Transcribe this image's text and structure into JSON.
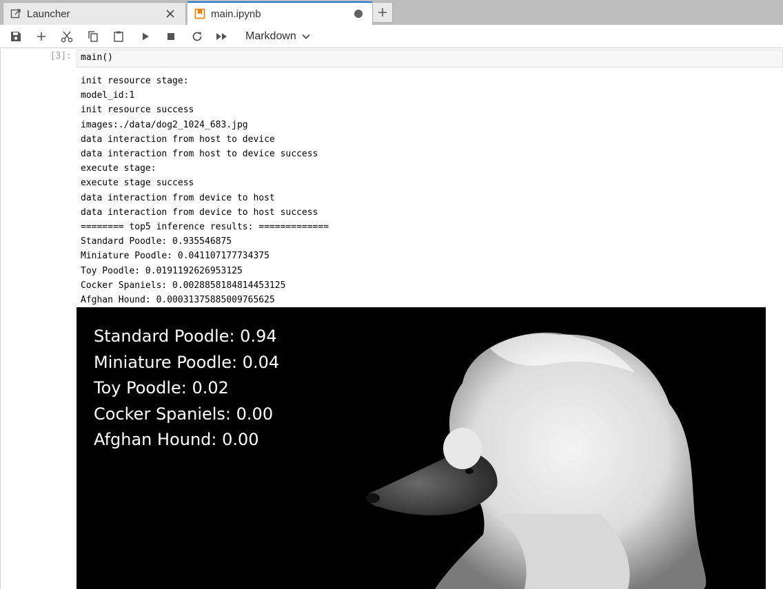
{
  "tabs": [
    {
      "label": "Launcher",
      "icon": "launcher-icon",
      "state": "inactive"
    },
    {
      "label": "main.ipynb",
      "icon": "notebook-icon",
      "state": "active-unsaved"
    }
  ],
  "toolbar": {
    "buttons": [
      "save-icon",
      "add-cell-icon",
      "cut-icon",
      "copy-icon",
      "paste-icon",
      "run-icon",
      "stop-icon",
      "restart-icon",
      "run-all-icon"
    ],
    "cell_type": "Markdown"
  },
  "cell": {
    "prompt": "[3]:",
    "input": "main()",
    "output_lines": [
      "init resource stage:",
      "model_id:1",
      "init resource success",
      "images:./data/dog2_1024_683.jpg",
      "data interaction from host to device",
      "data interaction from host to device success",
      "execute stage:",
      "execute stage success",
      "data interaction from device to host",
      "data interaction from device to host success",
      "======== top5 inference results: =============",
      "Standard Poodle: 0.935546875",
      "Miniature Poodle: 0.041107177734375",
      "Toy Poodle: 0.0191192626953125",
      "Cocker Spaniels: 0.0028858184814453125",
      "Afghan Hound: 0.00031375885009765625"
    ],
    "image_labels": [
      "Standard Poodle: 0.94",
      "Miniature Poodle: 0.04",
      "Toy Poodle: 0.02",
      "Cocker Spaniels: 0.00",
      "Afghan Hound: 0.00"
    ]
  },
  "colors": {
    "accent": "#1976d2",
    "notebook_icon": "#f57c00"
  }
}
